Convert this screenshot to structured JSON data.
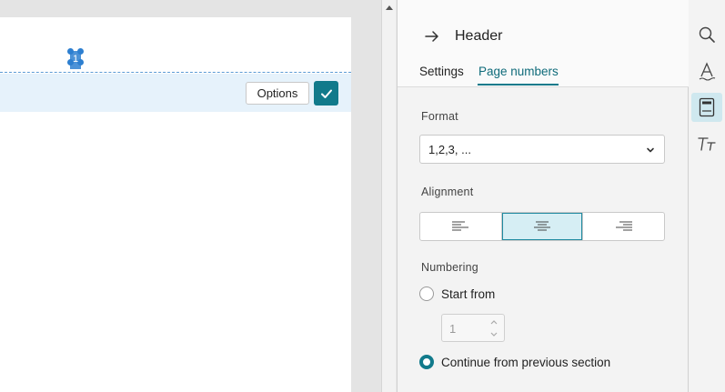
{
  "document": {
    "page_number_field": "1",
    "options_label": "Options"
  },
  "panel": {
    "title": "Header",
    "tabs": [
      {
        "label": "Settings",
        "active": false
      },
      {
        "label": "Page numbers",
        "active": true
      }
    ],
    "format": {
      "label": "Format",
      "value": "1,2,3, ..."
    },
    "alignment": {
      "label": "Alignment",
      "selected": "center",
      "options": [
        "left",
        "center",
        "right"
      ]
    },
    "numbering": {
      "label": "Numbering",
      "start_from_label": "Start from",
      "start_from_value": "1",
      "continue_label": "Continue from previous section",
      "selected": "continue"
    }
  },
  "rail": {
    "items": [
      {
        "icon": "search-icon",
        "active": false
      },
      {
        "icon": "text-style-icon",
        "active": false
      },
      {
        "icon": "header-footer-icon",
        "active": true
      },
      {
        "icon": "typography-icon",
        "active": false
      }
    ]
  },
  "colors": {
    "accent": "#117a8b",
    "header_band": "#e6f2fb",
    "field_marker": "#2d7fd0"
  }
}
